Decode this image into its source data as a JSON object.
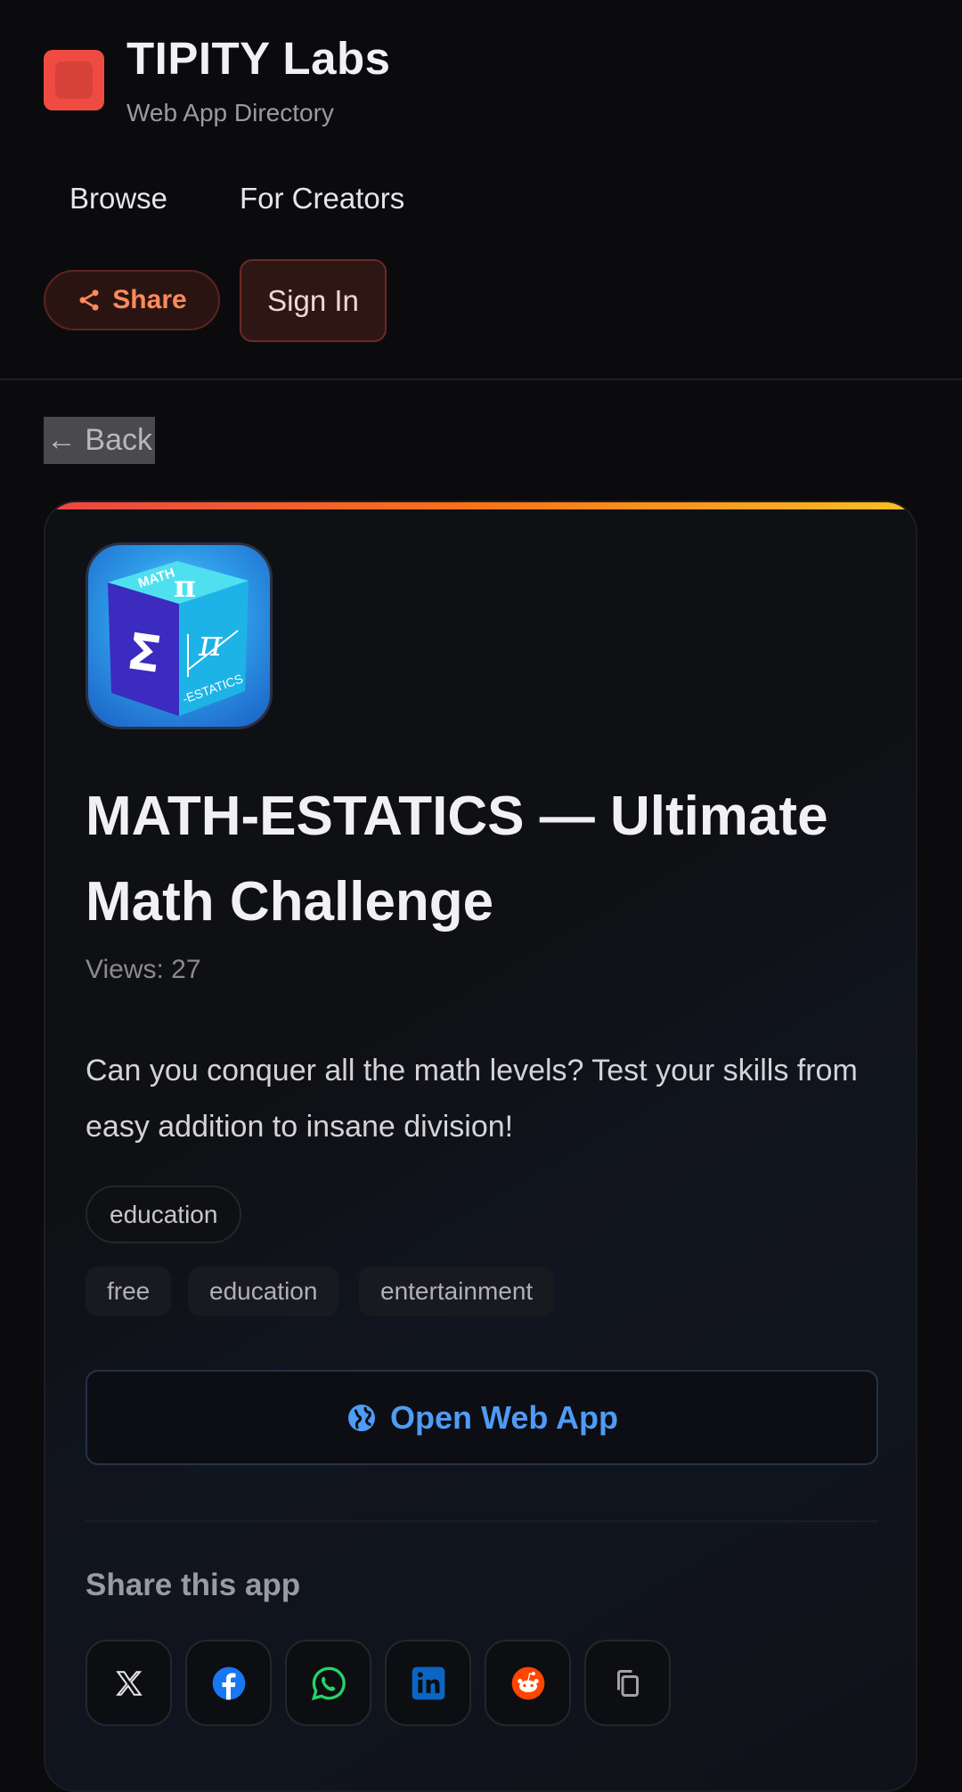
{
  "brand": {
    "title": "TIPITY Labs",
    "subtitle": "Web App Directory",
    "accent": "#ef4b43"
  },
  "nav": {
    "items": [
      {
        "label": "Browse"
      },
      {
        "label": "For Creators"
      }
    ]
  },
  "actions": {
    "share_label": "Share",
    "signin_label": "Sign In"
  },
  "back_label": "← Back",
  "app": {
    "icon_name": "math-cube-icon",
    "icon_text": {
      "top": "MATH",
      "pi": "π",
      "sigma": "Σ",
      "side": "-ESTATICS"
    },
    "title": "MATH-ESTATICS — Ultimate Math Challenge",
    "views": "Views: 27",
    "description": "Can you conquer all the math levels? Test your skills from easy addition to insane division!",
    "category": "education",
    "tags": [
      "free",
      "education",
      "entertainment"
    ],
    "open_label": "Open Web App",
    "link_color": "#4f9bf5"
  },
  "share_section": {
    "heading": "Share this app",
    "buttons": [
      {
        "name": "x-icon",
        "color": "#e8e8ea"
      },
      {
        "name": "facebook-icon",
        "color": "#1877f2"
      },
      {
        "name": "whatsapp-icon",
        "color": "#25d366"
      },
      {
        "name": "linkedin-icon",
        "color": "#0a66c2"
      },
      {
        "name": "reddit-icon",
        "color": "#ff4500"
      },
      {
        "name": "copy-icon",
        "color": "#a0a0a6"
      }
    ]
  }
}
